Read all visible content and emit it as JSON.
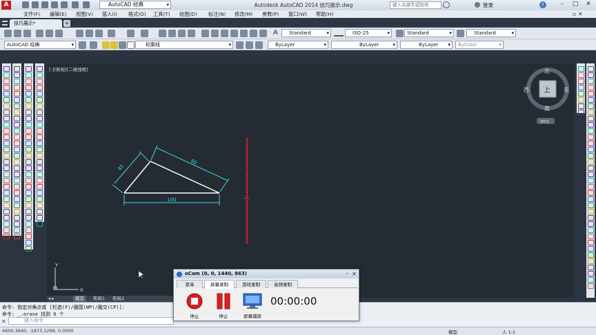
{
  "titlebar": {
    "workspace": "AutoCAD 经典",
    "title": "Autodesk AutoCAD 2014    技巧展示.dwg",
    "search_placeholder": "键入关键字或短语",
    "login": "登录"
  },
  "menu": [
    "文件(F)",
    "编辑(E)",
    "视图(V)",
    "插入(I)",
    "格式(O)",
    "工具(T)",
    "绘图(D)",
    "标注(N)",
    "修改(M)",
    "参数(P)",
    "窗口(W)",
    "帮助(H)"
  ],
  "doc_tab": "技巧展示*",
  "toolbar1": {
    "text_style": "Standard",
    "dim_style": "ISO-25",
    "table_style": "Standard",
    "multileader_style": "Standard"
  },
  "toolbar2": {
    "workspace": "AutoCAD 经典",
    "layer": "轮廓线",
    "color": "ByLayer",
    "linetype": "ByLayer",
    "lineweight": "ByLayer",
    "plotstyle": "ByColor"
  },
  "viewport": {
    "label": "[-][俯视][二维线框]",
    "compass": {
      "north": "北",
      "south": "南",
      "east": "东",
      "west": "西",
      "top": "上",
      "wcs": "WCS"
    },
    "ucs_y": "Y",
    "ucs_x": "X"
  },
  "drawing": {
    "dims": [
      "45",
      "80",
      "100"
    ]
  },
  "layout_tabs": [
    "模型",
    "布局1",
    "布局2"
  ],
  "command": {
    "line1": "命令: 指定对角点或 [栏选(F)/圈围(WP)/圈交(CP)]:",
    "line2": "命令: _.erase 找到 6 个",
    "placeholder": "键入命令"
  },
  "statusbar": {
    "coords": "4600.3640, -1873.1299, 0.0000",
    "model": "模型",
    "scale": "人 1:1"
  },
  "ocam": {
    "title": "oCam (0, 0, 1440, 863)",
    "tabs": [
      "菜单",
      "屏幕录制",
      "游戏录制",
      "音频录制"
    ],
    "buttons": [
      "停止",
      "停止",
      "屏幕捕获"
    ],
    "timer": "00:00:00"
  },
  "colors": {
    "canvas": "#252b33",
    "line_white": "#ffffff",
    "dim_cyan": "#3fd6e0",
    "highlight_red": "#ff2020"
  }
}
